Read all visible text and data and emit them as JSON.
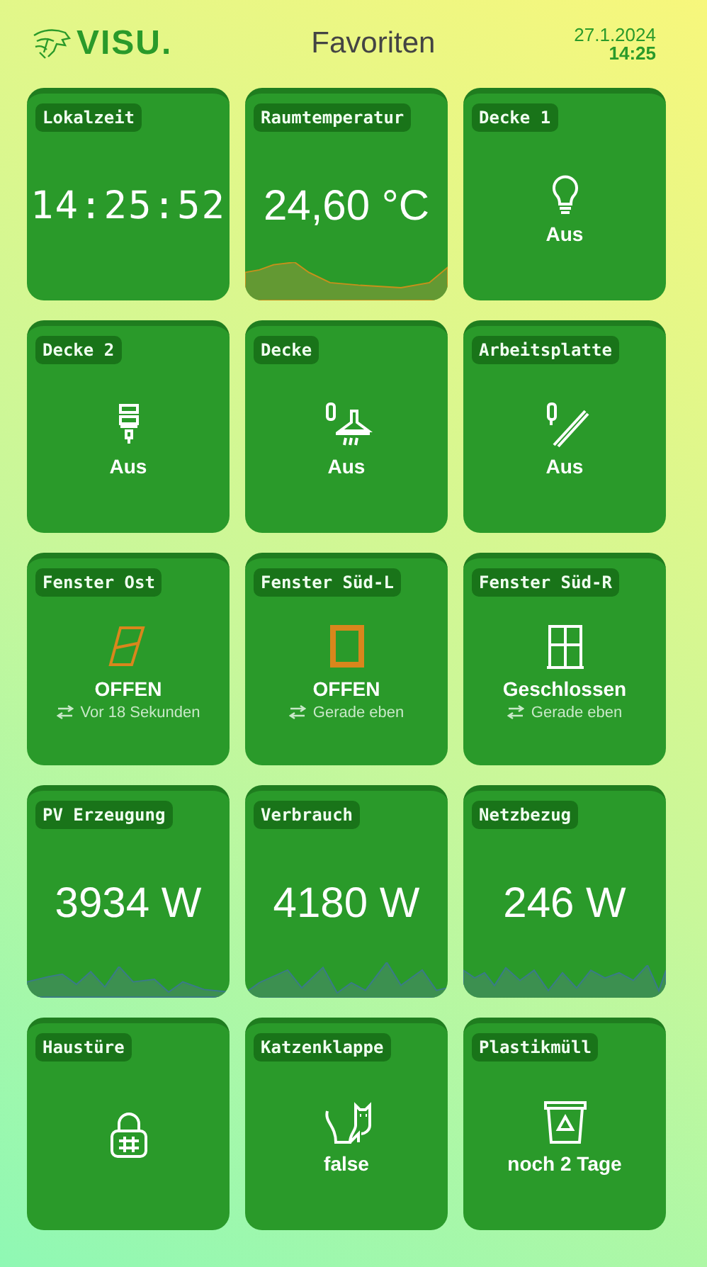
{
  "header": {
    "logo": "VISU.",
    "title": "Favoriten",
    "date": "27.1.2024",
    "time": "14:25"
  },
  "tiles": [
    {
      "kind": "clock",
      "label": "Lokalzeit",
      "value": "14:25:52"
    },
    {
      "kind": "value",
      "label": "Raumtemperatur",
      "value": "24,60 °C"
    },
    {
      "kind": "icon",
      "label": "Decke 1",
      "status": "Aus"
    },
    {
      "kind": "icon",
      "label": "Decke 2",
      "status": "Aus"
    },
    {
      "kind": "icon",
      "label": "Decke",
      "status": "Aus"
    },
    {
      "kind": "icon",
      "label": "Arbeitsplatte",
      "status": "Aus"
    },
    {
      "kind": "window",
      "label": "Fenster Ost",
      "status": "OFFEN",
      "open": true,
      "changed": "Vor 18 Sekunden"
    },
    {
      "kind": "window",
      "label": "Fenster Süd-L",
      "status": "OFFEN",
      "open": true,
      "changed": "Gerade eben"
    },
    {
      "kind": "window",
      "label": "Fenster Süd-R",
      "status": "Geschlossen",
      "open": false,
      "changed": "Gerade eben"
    },
    {
      "kind": "value",
      "label": "PV Erzeugung",
      "value": "3934 W"
    },
    {
      "kind": "value",
      "label": "Verbrauch",
      "value": "4180 W"
    },
    {
      "kind": "value",
      "label": "Netzbezug",
      "value": "246 W"
    },
    {
      "kind": "icon",
      "label": "Haustüre"
    },
    {
      "kind": "icon",
      "label": "Katzenklappe",
      "status": "false"
    },
    {
      "kind": "icon",
      "label": "Plastikmüll",
      "status": "noch 2 Tage"
    }
  ]
}
